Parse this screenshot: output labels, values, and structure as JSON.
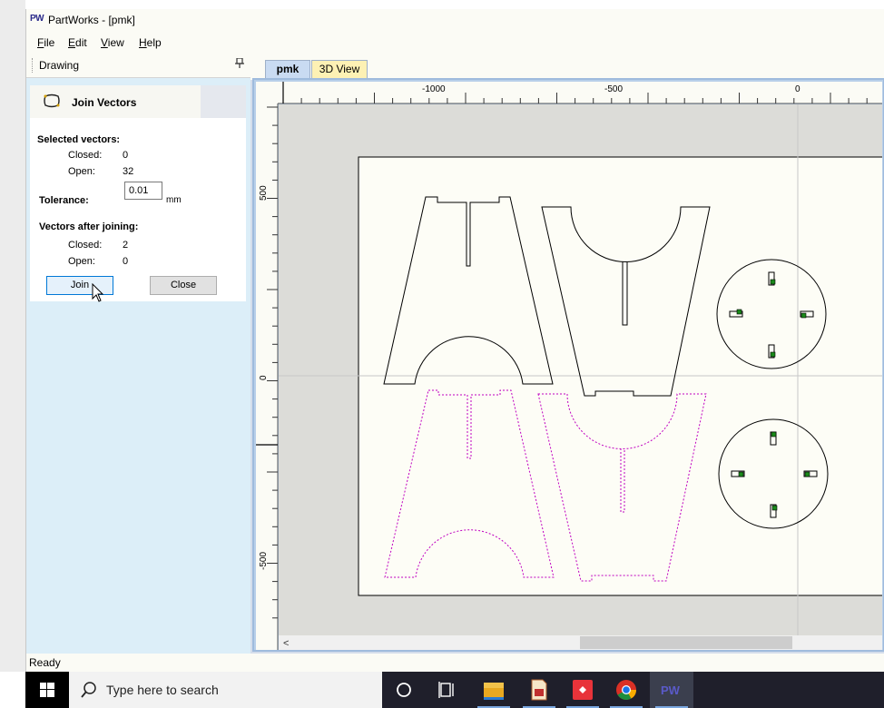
{
  "window": {
    "app_icon": "PW",
    "title": "PartWorks - [pmk]"
  },
  "menu": {
    "items": [
      {
        "label": "File",
        "underline": "F",
        "rest": "ile"
      },
      {
        "label": "Edit",
        "underline": "E",
        "rest": "dit"
      },
      {
        "label": "View",
        "underline": "V",
        "rest": "iew"
      },
      {
        "label": "Help",
        "underline": "H",
        "rest": "elp"
      }
    ]
  },
  "left_panel": {
    "header_label": "Drawing",
    "pin_icon": "pin-icon",
    "form": {
      "title": "Join Vectors",
      "title_icon": "join-vectors-icon",
      "selected_heading": "Selected vectors:",
      "selected_closed_label": "Closed:",
      "selected_closed_value": "0",
      "selected_open_label": "Open:",
      "selected_open_value": "32",
      "tolerance_label": "Tolerance:",
      "tolerance_value": "0.01",
      "tolerance_unit": "mm",
      "after_heading": "Vectors after joining:",
      "after_closed_label": "Closed:",
      "after_closed_value": "2",
      "after_open_label": "Open:",
      "after_open_value": "0",
      "join_button": "Join",
      "close_button": "Close"
    }
  },
  "tabs": [
    {
      "label": "pmk",
      "active": true
    },
    {
      "label": "3D View",
      "active": false
    }
  ],
  "ruler": {
    "top_labels": [
      "-1000",
      "-500",
      "0"
    ],
    "left_labels": [
      "500",
      "0",
      "-500"
    ]
  },
  "canvas": {
    "solid_color": "#000000",
    "dashed_color": "#c000c0",
    "marker_color": "#1a8a1a",
    "background": "#dcdcd8",
    "sheet": "#fdfdf6",
    "scroll_left_arrow": "<"
  },
  "status": {
    "text": "Ready"
  },
  "taskbar": {
    "search_placeholder": "Type here to search",
    "pinned": [
      "windows-start-icon",
      "cortana-icon",
      "task-view-icon",
      "file-explorer-icon",
      "document-app-icon",
      "anydesk-icon",
      "chrome-icon",
      "partworks-icon"
    ],
    "partworks_label": "PW"
  }
}
